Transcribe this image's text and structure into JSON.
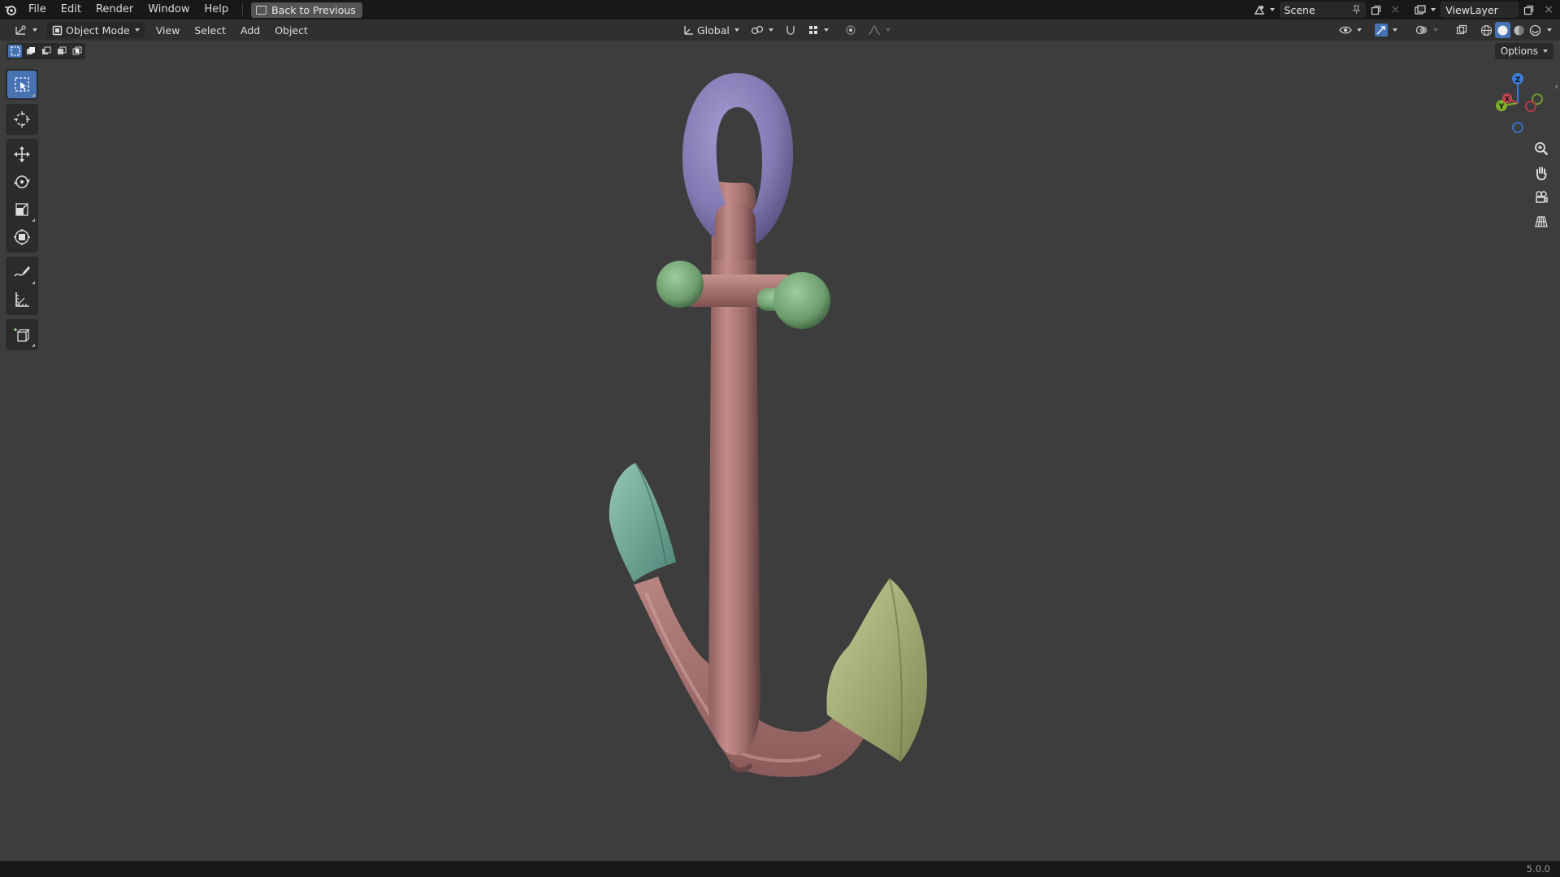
{
  "topbar": {
    "menu": [
      "File",
      "Edit",
      "Render",
      "Window",
      "Help"
    ],
    "back_label": "Back to Previous",
    "scene": "Scene",
    "view_layer": "ViewLayer"
  },
  "header": {
    "mode": "Object Mode",
    "menu": [
      "View",
      "Select",
      "Add",
      "Object"
    ],
    "orientation": "Global"
  },
  "viewport": {
    "options_label": "Options",
    "axes": {
      "z": "Z",
      "y": "Y",
      "x": "X"
    }
  },
  "status": {
    "version": "5.0.0"
  },
  "colors": {
    "accent": "#4772b3",
    "ring": "#8b82b8",
    "shank": "#b57f7d",
    "stock": "#79a97a",
    "fluke_left": "#7db0a0",
    "fluke_right": "#a9b27a"
  }
}
